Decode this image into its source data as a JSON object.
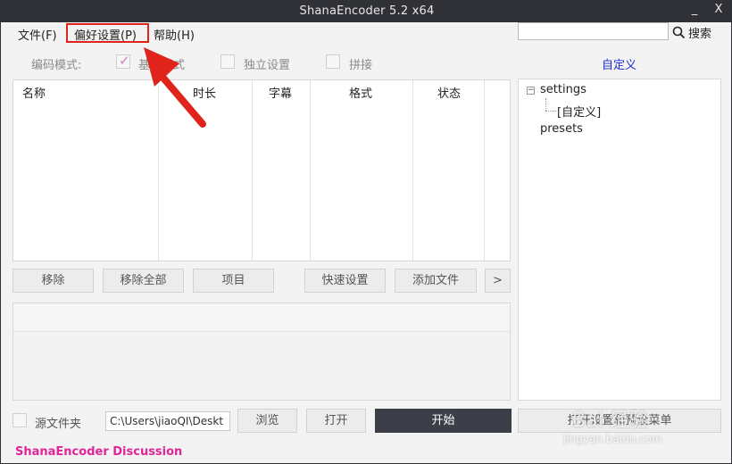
{
  "window": {
    "title": "ShanaEncoder 5.2 x64",
    "minimize_glyph": "_",
    "close_glyph": "X"
  },
  "menu": {
    "file": "文件(F)",
    "preferences": "偏好设置(P)",
    "help": "帮助(H)"
  },
  "search": {
    "value": "",
    "placeholder": "",
    "button_label": "搜索",
    "icon": "search-icon"
  },
  "mode": {
    "label": "编码模式:",
    "basic": "基本模式",
    "basic_checked": true,
    "independent": "独立设置",
    "independent_checked": false,
    "concat": "拼接",
    "concat_checked": false,
    "custom_link": "自定义"
  },
  "file_table": {
    "columns": [
      "名称",
      "时长",
      "字幕",
      "格式",
      "状态"
    ],
    "rows": []
  },
  "tree": {
    "root": "settings",
    "root_child": "[自定义]",
    "second": "presets"
  },
  "buttons": {
    "remove": "移除",
    "remove_all": "移除全部",
    "item": "项目",
    "quick_settings": "快速设置",
    "add_file": "添加文件",
    "more": ">",
    "browse": "浏览",
    "open": "打开",
    "start": "开始",
    "preset_menu": "打开设置和预设菜单"
  },
  "output": {
    "source_folder_label": "源文件夹",
    "source_folder_checked": false,
    "path_value": "C:\\Users\\jiaoQI\\Deskt"
  },
  "footer": {
    "discussion": "ShanaEncoder Discussion"
  },
  "annotation": {
    "color": "#e0231b"
  },
  "watermark": {
    "text": "Bai 经验",
    "url": "jingyan.baidu.com"
  },
  "colors": {
    "titlebar": "#2f3137",
    "accent_link": "#1b2fcf",
    "discussion": "#e0259b",
    "start_button": "#3c3f47"
  }
}
